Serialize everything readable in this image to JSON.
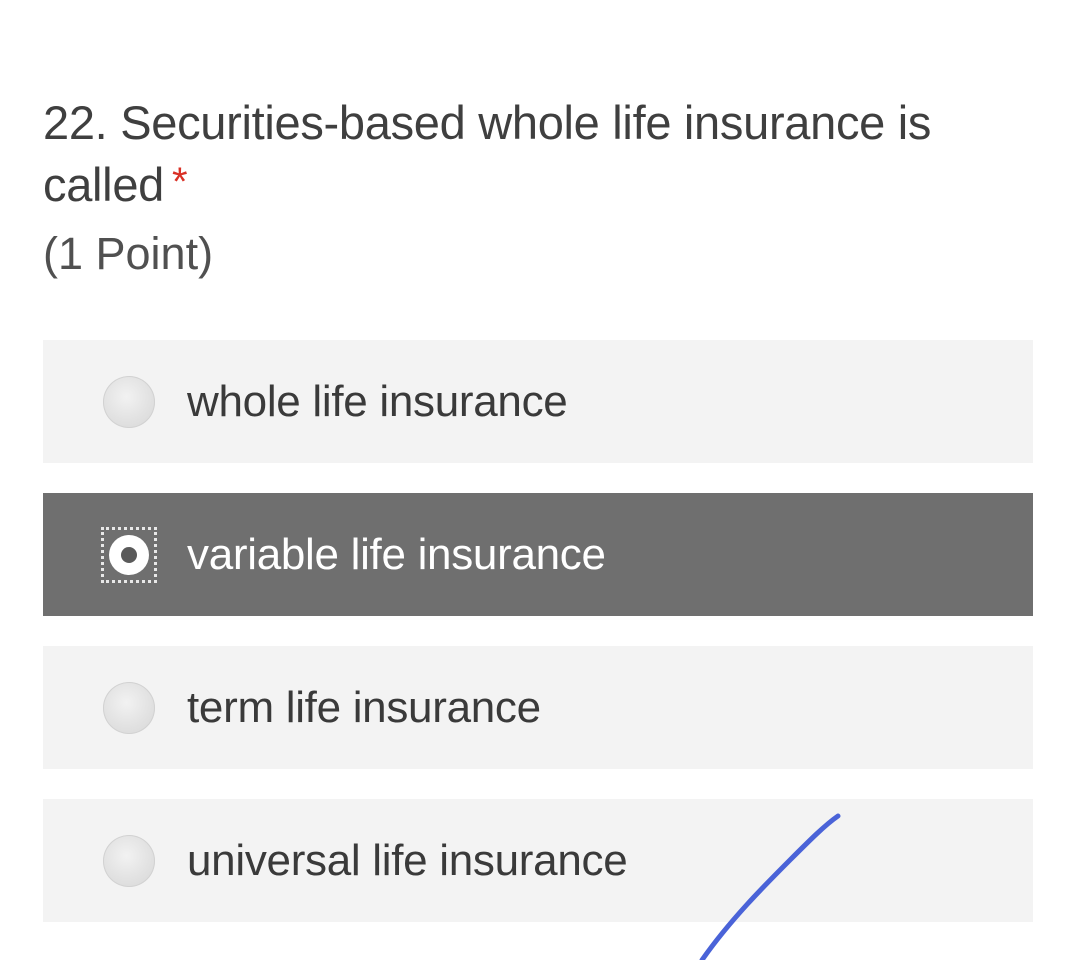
{
  "question": {
    "number_and_text": "22. Securities-based whole life insurance is called",
    "required_marker": "*",
    "points": "(1 Point)"
  },
  "options": [
    {
      "label": "whole life insurance",
      "selected": false
    },
    {
      "label": "variable life insurance",
      "selected": true
    },
    {
      "label": "term life insurance",
      "selected": false
    },
    {
      "label": "universal life insurance",
      "selected": false
    }
  ],
  "annotation": {
    "icon": "pen-checkmark-stroke",
    "color": "#4a63d8"
  },
  "colors": {
    "selected_option_bg": "#6f6f6f",
    "option_bg": "#f3f3f3",
    "required": "#d93025"
  }
}
